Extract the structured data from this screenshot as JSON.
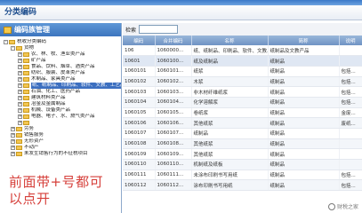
{
  "window": {
    "page_title": "分类编码"
  },
  "left_panel": {
    "header": "编码族管理",
    "tree": [
      {
        "label": "税收分类编码",
        "level": 0,
        "expander": "-"
      },
      {
        "label": "货物",
        "level": 1,
        "expander": "-"
      },
      {
        "label": "农、林、牧、渔业类产品",
        "level": 2,
        "expander": "+"
      },
      {
        "label": "矿产品",
        "level": 2,
        "expander": "+"
      },
      {
        "label": "食品、饮料、烟草、酒类产品",
        "level": 2,
        "expander": "+"
      },
      {
        "label": "纺织、服装、皮革类产品",
        "level": 2,
        "expander": "+"
      },
      {
        "label": "木制品、家具类产品",
        "level": 2,
        "expander": "+"
      },
      {
        "label": "纸、纸制品、印刷品、软件、文教、工艺品",
        "level": 2,
        "expander": "+",
        "selected": true
      },
      {
        "label": "石油、化工、医药产品",
        "level": 2,
        "expander": "+"
      },
      {
        "label": "建筑材料类产品",
        "level": 2,
        "expander": "+"
      },
      {
        "label": "冶金及金属制品",
        "level": 2,
        "expander": "+"
      },
      {
        "label": "机械、设备类产品",
        "level": 2,
        "expander": "+"
      },
      {
        "label": "电器、电子、水、燃气类产品",
        "level": 2,
        "expander": "+"
      },
      {
        "label": "",
        "level": 2,
        "expander": "+"
      },
      {
        "label": "劳务",
        "level": 1,
        "expander": "+"
      },
      {
        "label": "销售服务",
        "level": 1,
        "expander": "+"
      },
      {
        "label": "无形资产",
        "level": 1,
        "expander": "+"
      },
      {
        "label": "不动产",
        "level": 1,
        "expander": "+"
      },
      {
        "label": "未发生销售行为的不征税项目",
        "level": 1,
        "expander": "+"
      }
    ]
  },
  "annotation": "前面带+号都可以点开",
  "right_panel": {
    "search_label": "检索",
    "search_value": "",
    "columns": [
      "编码",
      "合并编码",
      "名称",
      "简称",
      "说明"
    ],
    "rows": [
      [
        "106",
        "1060000...",
        "纸、纸制品、印刷品、软件、文教...",
        "纸制品及文教产品",
        ""
      ],
      [
        "10601",
        "1060100...",
        "纸及纸制品",
        "纸制品",
        ""
      ],
      [
        "1060101",
        "1060101...",
        "纸浆",
        "纸制品",
        "包括..."
      ],
      [
        "1060102",
        "1060102...",
        "木浆",
        "纸制品",
        "包括..."
      ],
      [
        "1060103",
        "1060103...",
        "非木材纤维纸浆",
        "纸制品",
        "包括..."
      ],
      [
        "1060104",
        "1060104...",
        "化学溶解浆",
        "纸制品",
        "包括..."
      ],
      [
        "1060105",
        "1060105...",
        "卷纸浆",
        "纸制品",
        "金废..."
      ],
      [
        "1060106",
        "1060106...",
        "其他纸浆",
        "纸制品",
        "废纸..."
      ],
      [
        "1060107",
        "1060107...",
        "纸制品",
        "纸制品",
        ""
      ],
      [
        "1060108",
        "1060108...",
        "其他纸浆",
        "纸制品",
        ""
      ],
      [
        "1060109",
        "1060109...",
        "其他纸浆",
        "纸制品",
        ""
      ],
      [
        "1060110",
        "1060110...",
        "机制纸及纸板",
        "纸制品",
        ""
      ],
      [
        "1060111",
        "1060111...",
        "未涂布印刷书写用纸",
        "纸制品",
        "包括..."
      ],
      [
        "1060112",
        "1060112...",
        "涂布印刷书写用纸",
        "纸制品",
        "包括..."
      ]
    ]
  },
  "watermark": "财税之家"
}
